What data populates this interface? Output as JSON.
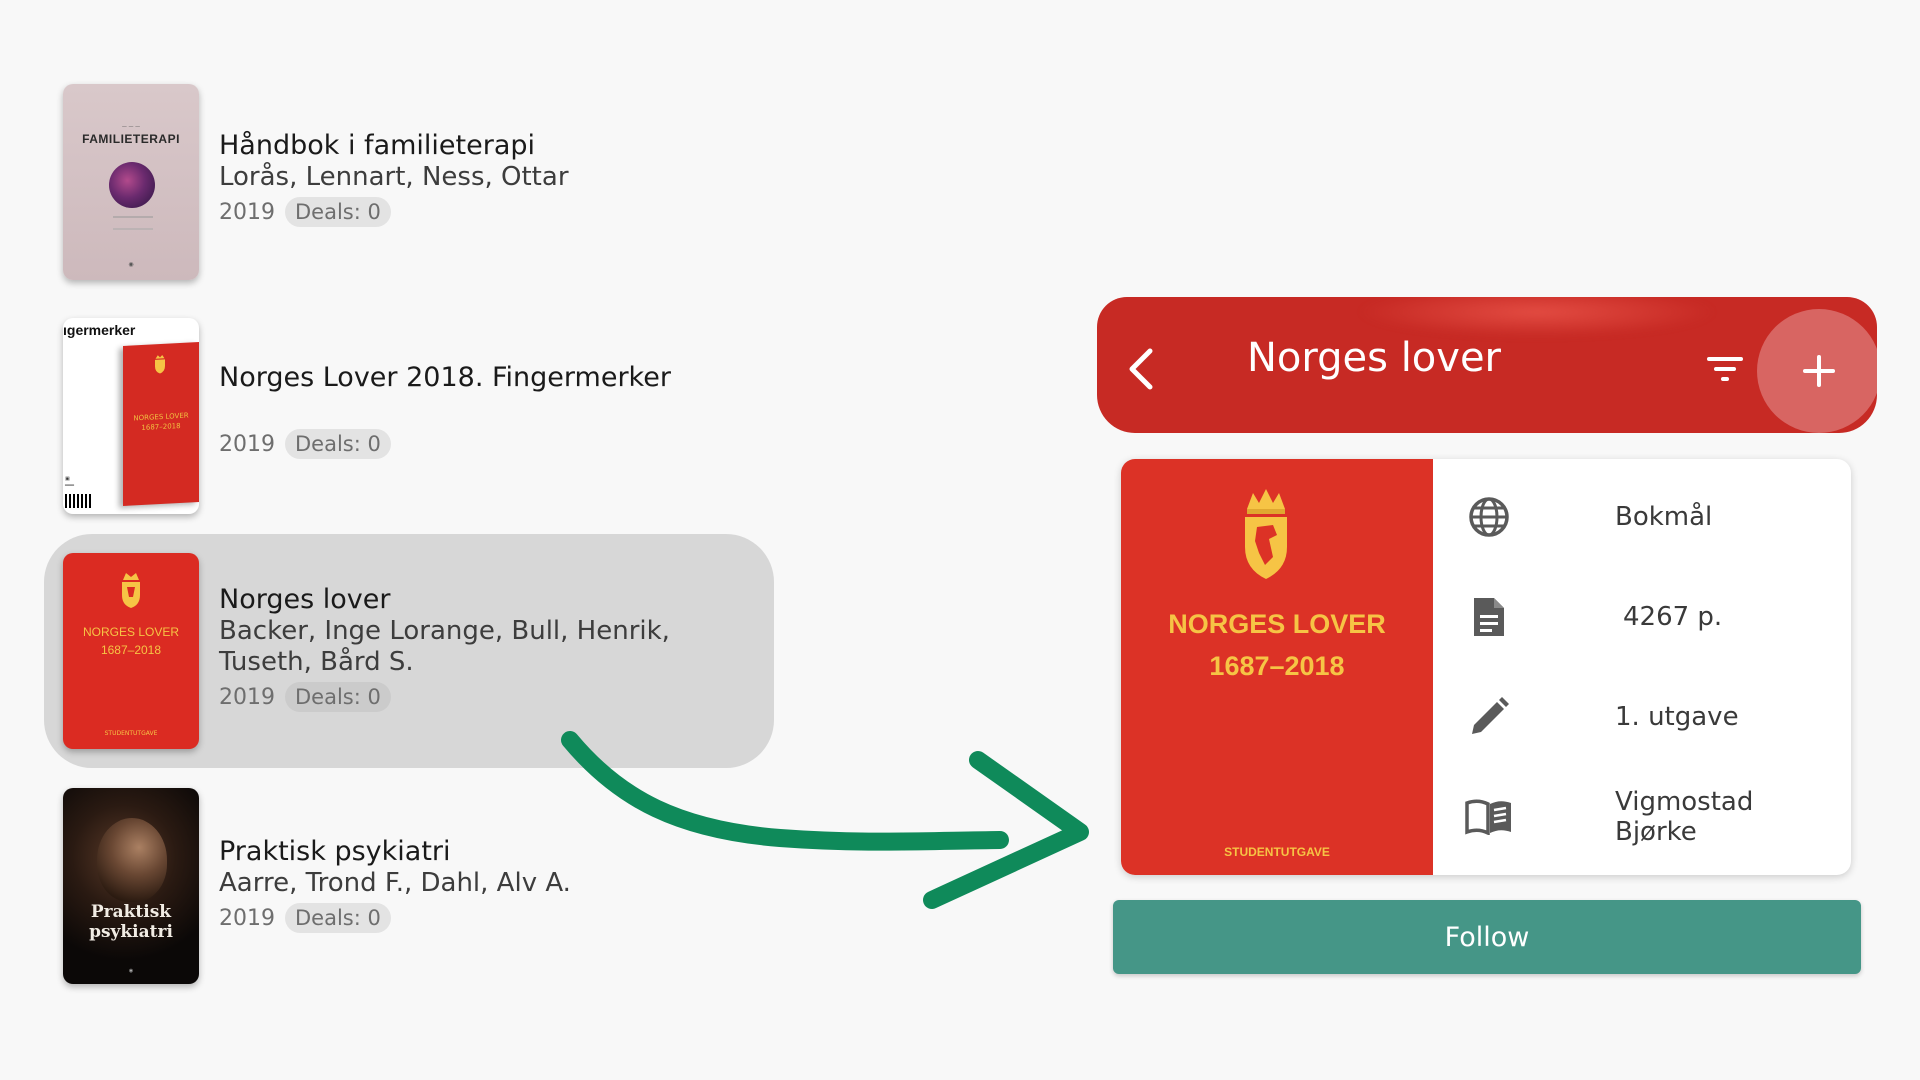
{
  "books": [
    {
      "title": "Håndbok i familieterapi",
      "authors": "Lorås, Lennart, Ness, Ottar",
      "year": "2019",
      "deals": "Deals: 0",
      "cover": {
        "label": "FAMILIETERAPI"
      }
    },
    {
      "title": "Norges Lover 2018. Fingermerker",
      "authors": "",
      "year": "2019",
      "deals": "Deals: 0",
      "cover": {
        "label": "ıgermerker",
        "book_text": "NORGES LOVER 1687–2018"
      }
    },
    {
      "title": "Norges lover",
      "authors": "Backer, Inge Lorange, Bull, Henrik, Tuseth, Bård S.",
      "year": "2019",
      "deals": "Deals: 0",
      "cover": {
        "line1": "NORGES LOVER",
        "line2": "1687–2018",
        "footer": "STUDENTUTGAVE"
      }
    },
    {
      "title": "Praktisk psykiatri",
      "authors": "Aarre, Trond F., Dahl, Alv A.",
      "year": "2019",
      "deals": "Deals: 0",
      "cover": {
        "title": "Praktisk psykiatri"
      }
    }
  ],
  "selected_index": 2,
  "detail": {
    "header_title": "Norges lover",
    "back_icon": "chevron-left-icon",
    "filter_icon": "filter-icon",
    "add_icon": "plus-icon",
    "cover": {
      "line1": "NORGES LOVER",
      "line2": "1687–2018",
      "footer": "STUDENTUTGAVE"
    },
    "info": {
      "language": "Bokmål",
      "pages": "4267 p.",
      "edition": "1. utgave",
      "publisher": "Vigmostad Bjørke"
    },
    "follow_label": "Follow"
  },
  "colors": {
    "header_red": "#c72a24",
    "cover_red": "#dc3226",
    "cover_gold": "#f6c445",
    "follow_teal": "#459687",
    "arrow_green": "#0f8a5a",
    "selected_row": "#d7d7d7"
  }
}
